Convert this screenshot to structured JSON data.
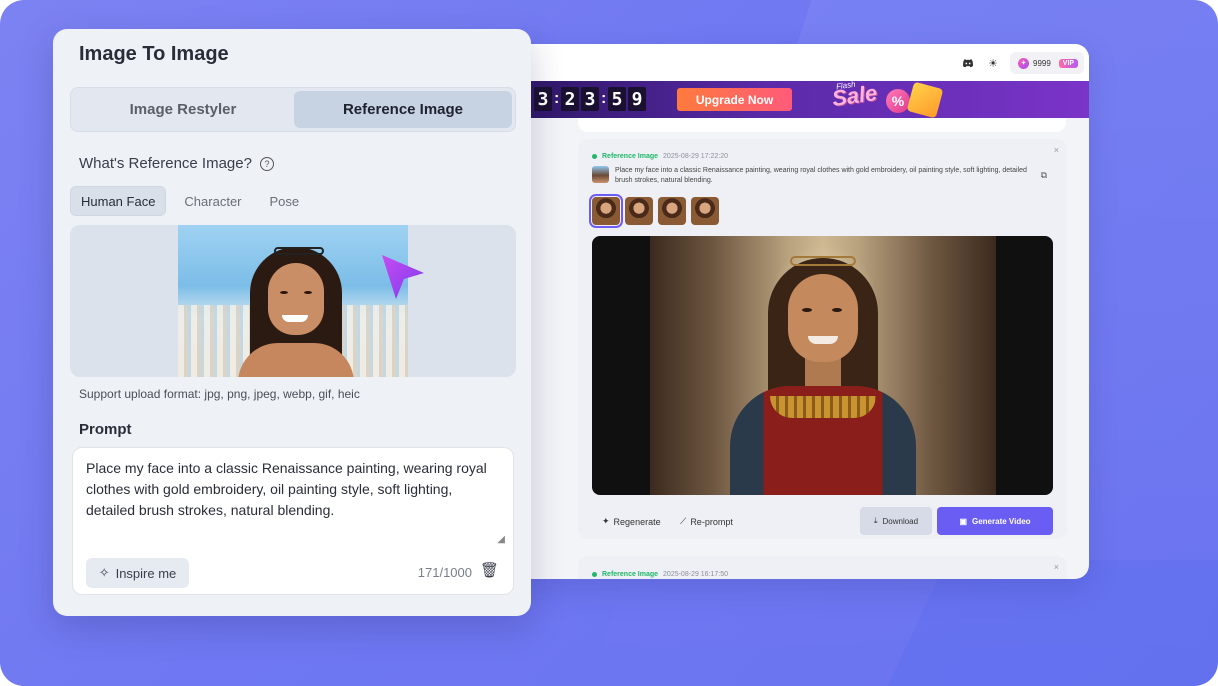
{
  "panel": {
    "title": "Image To Image",
    "modes": [
      "Image Restyler",
      "Reference Image"
    ],
    "active_mode": "Reference Image",
    "ref_question": "What's Reference Image?",
    "ref_help_icon": "question-circle-icon",
    "subtabs": [
      "Human Face",
      "Character",
      "Pose"
    ],
    "active_subtab": "Human Face",
    "support_formats": "Support upload format: jpg, png, jpeg, webp, gif, heic",
    "prompt_label": "Prompt",
    "prompt_text": "Place my face into a classic Renaissance painting, wearing royal clothes with gold embroidery, oil painting style, soft lighting, detailed brush strokes, natural blending.",
    "inspire_label": "Inspire me",
    "char_count": "171/1000"
  },
  "app": {
    "topbar": {
      "credits": "9999",
      "vip_label": "VIP",
      "icons": [
        "discord-icon",
        "sun-icon"
      ]
    },
    "banner": {
      "countdown": [
        "3",
        "2",
        "3",
        "5",
        "9"
      ],
      "upgrade_label": "Upgrade Now",
      "sale_flash": "Flash",
      "sale_word": "Sale",
      "sale_pct": "%"
    },
    "cards": [
      {
        "tag": "Reference Image",
        "time": "2025-08-29 17:22:20",
        "prompt": "Place my face into a classic Renaissance painting, wearing royal clothes with gold embroidery, oil painting style, soft lighting, detailed brush strokes, natural blending.",
        "actions": {
          "regenerate": "Regenerate",
          "reprompt": "Re-prompt",
          "download": "Download",
          "generate_video": "Generate Video"
        }
      },
      {
        "tag": "Reference Image",
        "time": "2025-08-29 16:17:50"
      }
    ]
  },
  "colors": {
    "accent": "#6a5df4",
    "success": "#1fb86a",
    "upgrade": "#ff6a5a",
    "background": "#7179f1"
  }
}
